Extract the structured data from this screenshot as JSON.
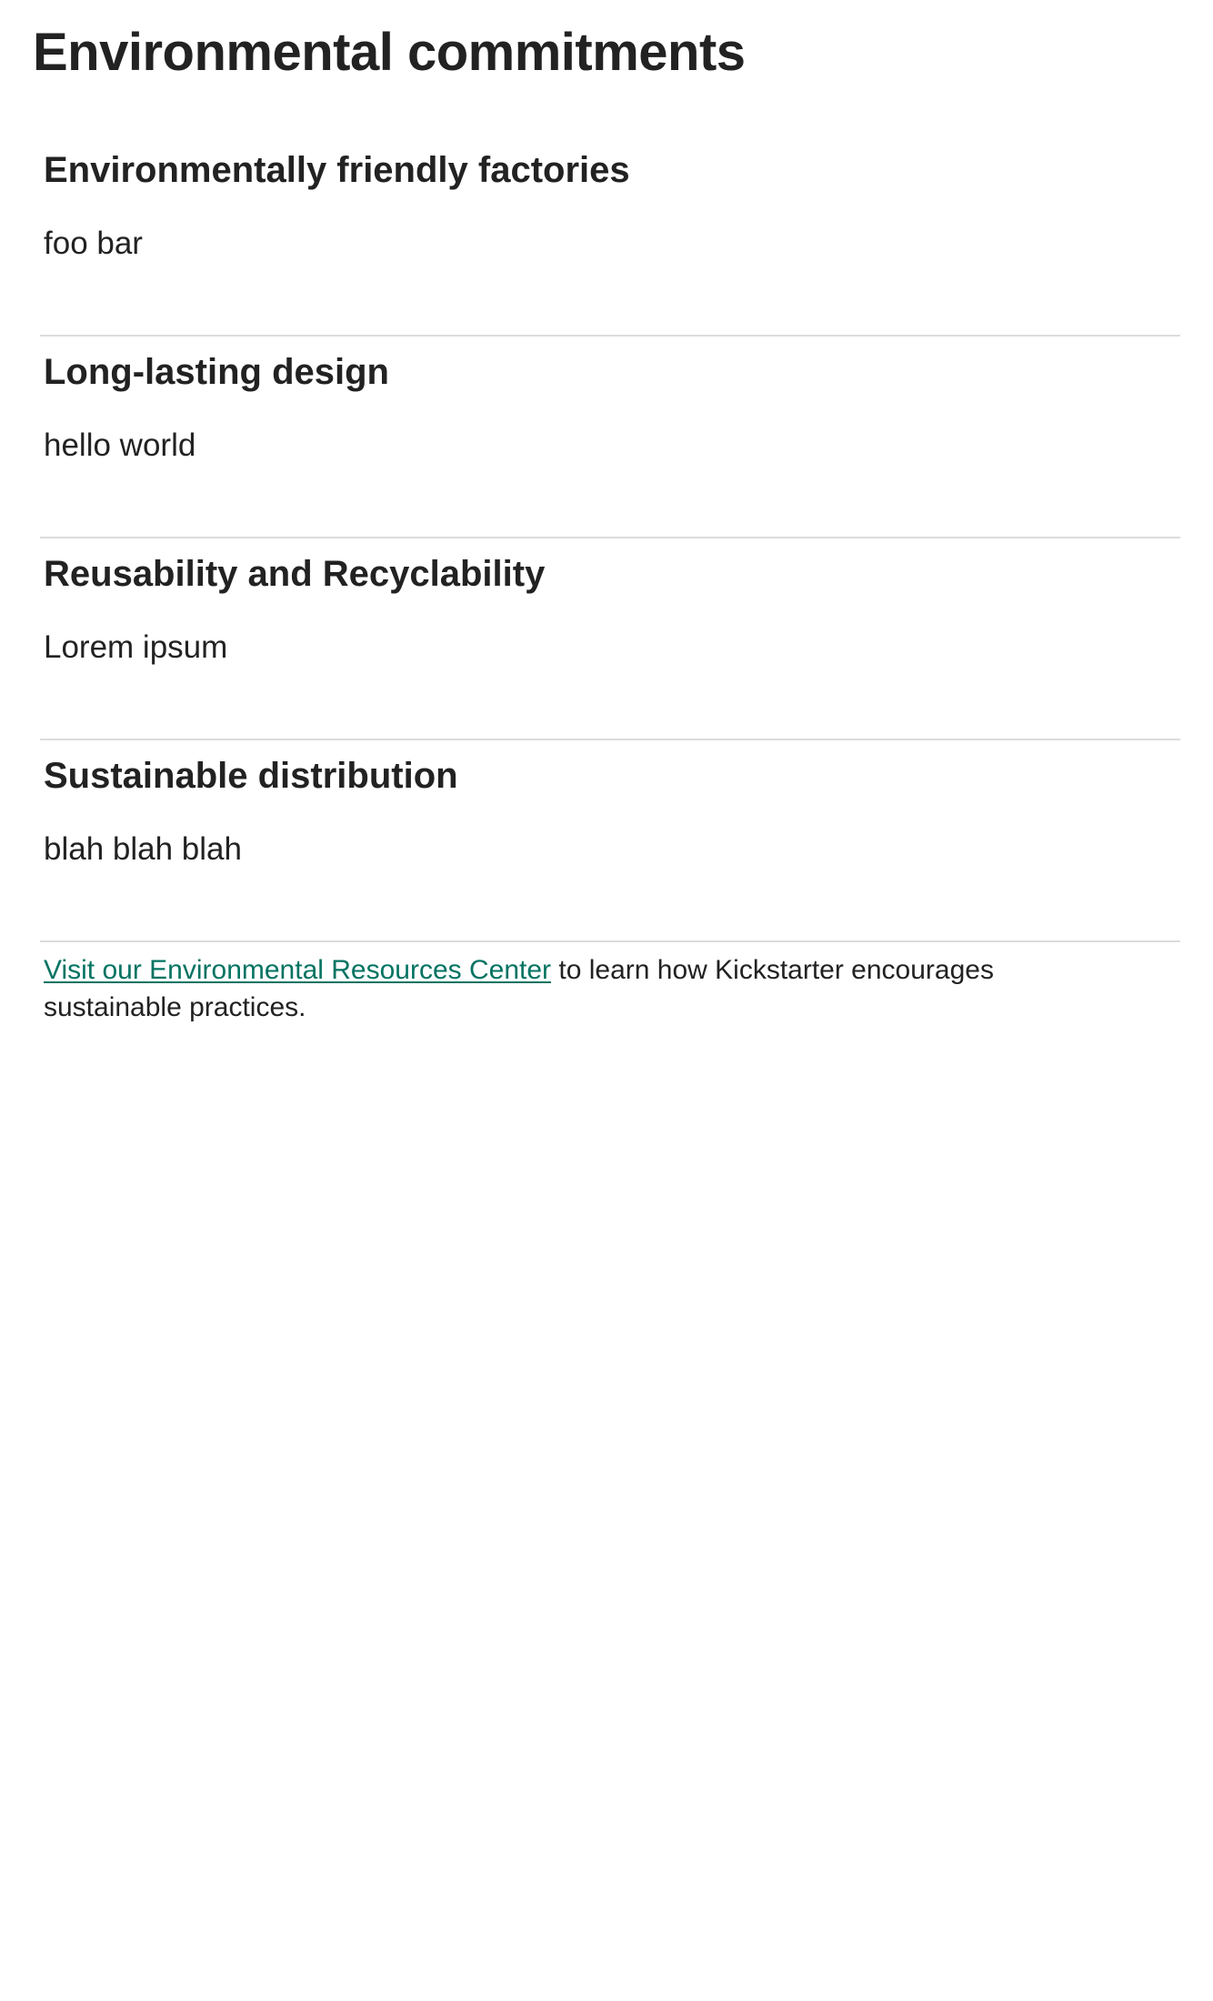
{
  "page": {
    "title": "Environmental commitments"
  },
  "commitments": [
    {
      "title": "Environmentally friendly factories",
      "body": "foo bar"
    },
    {
      "title": "Long-lasting design",
      "body": "hello world"
    },
    {
      "title": "Reusability and Recyclability",
      "body": "Lorem ipsum"
    },
    {
      "title": "Sustainable distribution",
      "body": "blah blah blah"
    }
  ],
  "footer": {
    "link_text": "Visit our Environmental Resources Center",
    "trailing_text": " to learn how Kickstarter encourages sustainable practices."
  },
  "colors": {
    "text": "#222222",
    "link": "#037362",
    "divider": "#dcdcdc",
    "background": "#ffffff"
  }
}
